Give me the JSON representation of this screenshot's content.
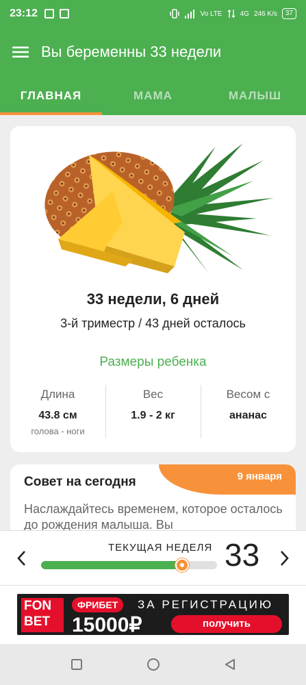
{
  "status_bar": {
    "time": "23:12",
    "network": "Vo LTE",
    "signal_label": "4G",
    "speed": "246 K/s",
    "battery": "37"
  },
  "app_bar": {
    "title": "Вы беременны 33 недели"
  },
  "tabs": [
    {
      "label": "ГЛАВНАЯ",
      "active": true
    },
    {
      "label": "МАМА",
      "active": false
    },
    {
      "label": "МАЛЫШ",
      "active": false
    }
  ],
  "main_card": {
    "image": "pineapple",
    "heading": "33 недели, 6 дней",
    "subheading": "3-й триместр / 43 дней осталось",
    "sizes_title": "Размеры ребенка",
    "stats": [
      {
        "label": "Длина",
        "value": "43.8 см",
        "note": "голова - ноги"
      },
      {
        "label": "Вес",
        "value": "1.9 - 2 кг",
        "note": ""
      },
      {
        "label": "Весом с",
        "value": "ананас",
        "note": ""
      }
    ]
  },
  "tip": {
    "title": "Совет на сегодня",
    "date": "9 января",
    "text": "Наслаждайтесь временем, которое осталось до рождения малыша. Вы"
  },
  "week_selector": {
    "label": "ТЕКУЩАЯ НЕДЕЛЯ",
    "week": "33",
    "progress_fraction": 0.8
  },
  "ad": {
    "logo": "FON BET",
    "promo": "ФРИБЕТ",
    "registration": "ЗА РЕГИСТРАЦИЮ",
    "amount": "15000₽",
    "button": "получить"
  },
  "colors": {
    "primary": "#4caf50",
    "accent": "#f7923a",
    "ad_red": "#e4102b"
  }
}
